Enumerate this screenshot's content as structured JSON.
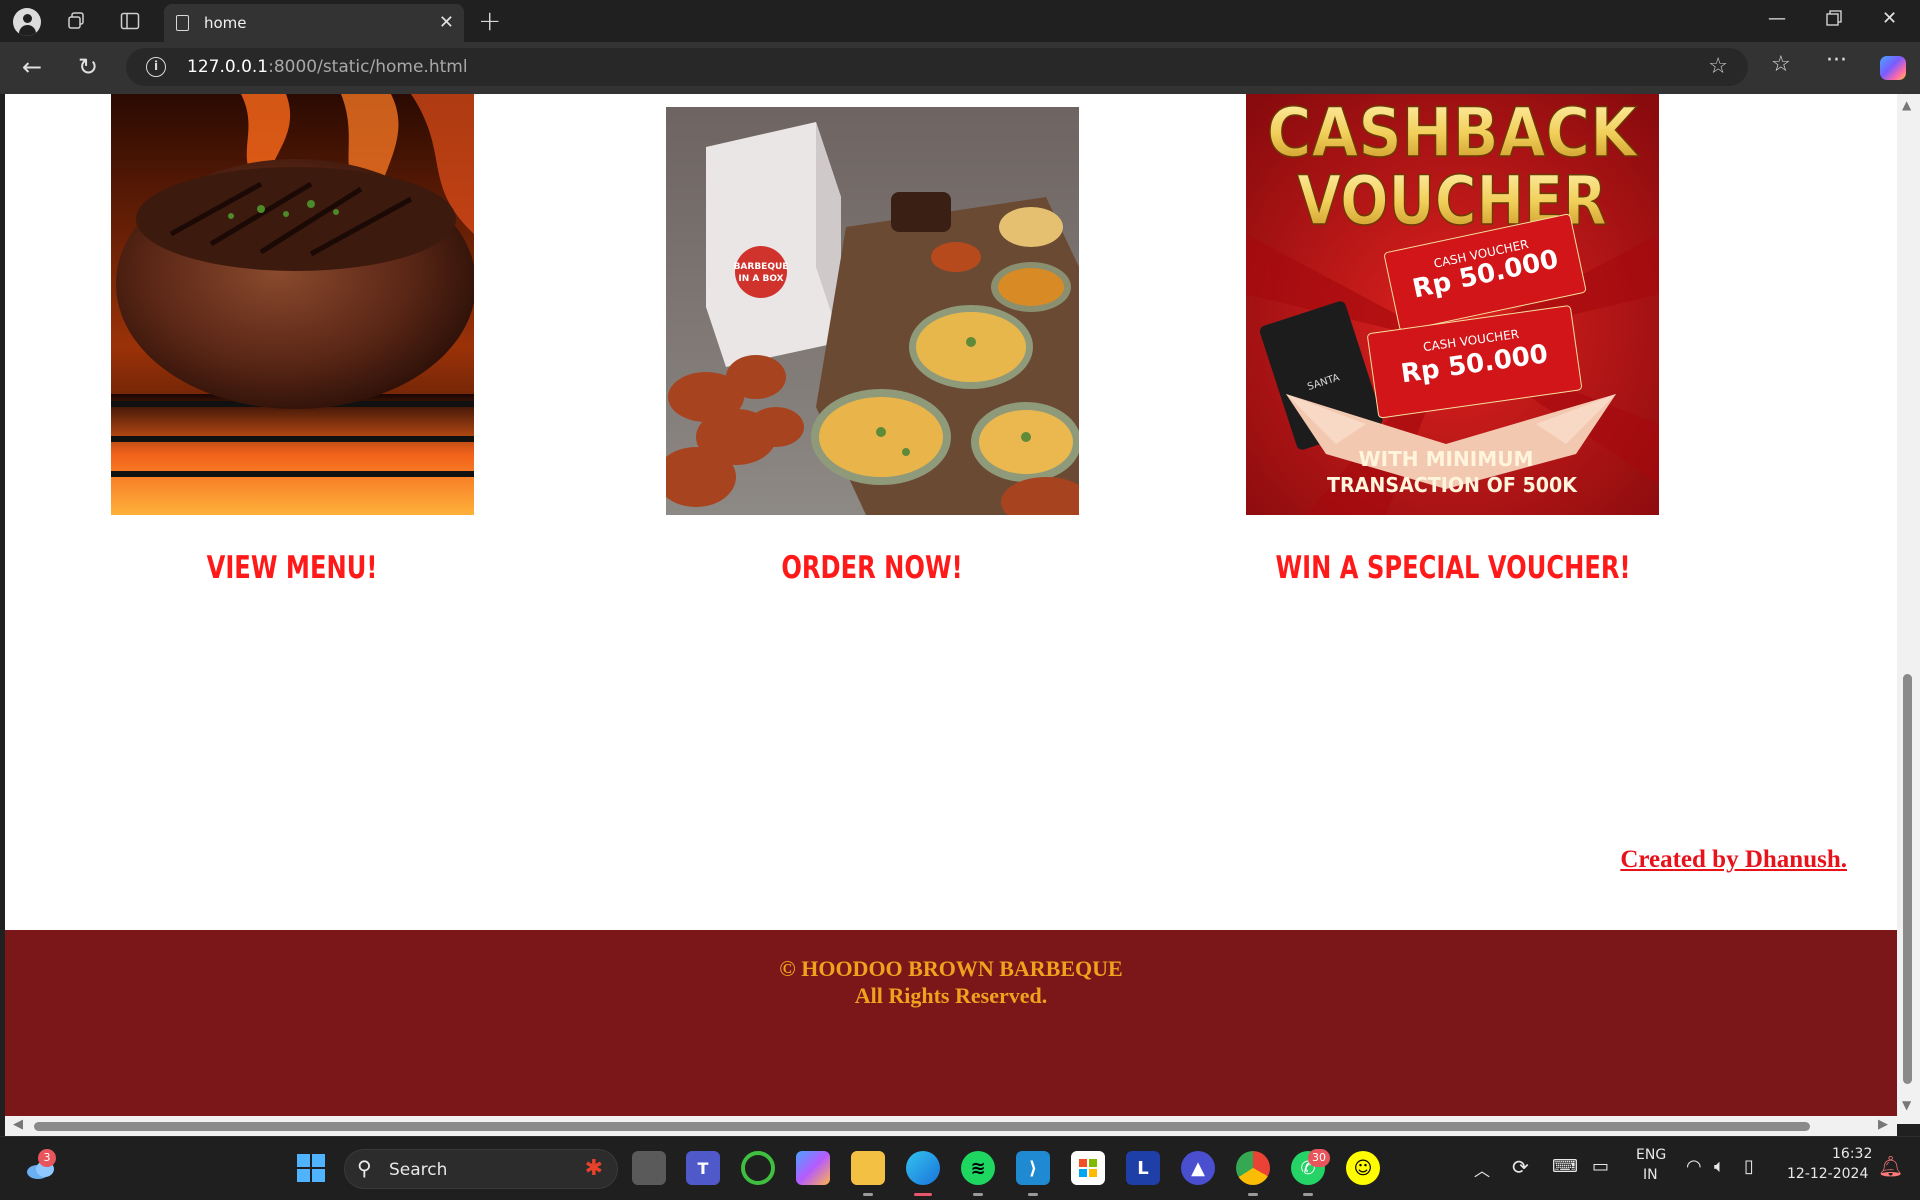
{
  "browser": {
    "tab_title": "home",
    "url_host": "127.0.0.1",
    "url_rest": ":8000/static/home.html"
  },
  "page": {
    "cards": [
      {
        "cta": "VIEW MENU!",
        "image": "grilled-steak-photo"
      },
      {
        "cta": "ORDER NOW!",
        "image": "barbeque-in-a-box-biryani-photo"
      },
      {
        "cta": "WIN A SPECIAL VOUCHER!",
        "image": "cashback-voucher-poster"
      }
    ],
    "voucher_poster": {
      "line1": "CASHBACK",
      "line2": "VOUCHER",
      "voucher_label": "CASH VOUCHER",
      "voucher_amount": "Rp 50.000",
      "bottom1": "WITH MINIMUM",
      "bottom2": "TRANSACTION OF 500K"
    },
    "box_label": "BARBEQUE IN A BOX",
    "credit": "Created by Dhanush.",
    "footer_line1": "© HOODOO BROWN BARBEQUE",
    "footer_line2": "All Rights Reserved.",
    "colors": {
      "cta": "#ff1a1a",
      "footer_bg": "#7b1619",
      "footer_text": "#f0a21f",
      "credit": "#e8121a"
    }
  },
  "taskbar": {
    "search_placeholder": "Search",
    "weather_badge": "3",
    "whatsapp_badge": "30",
    "lang_line1": "ENG",
    "lang_line2": "IN",
    "time": "16:32",
    "date": "12-12-2024"
  }
}
